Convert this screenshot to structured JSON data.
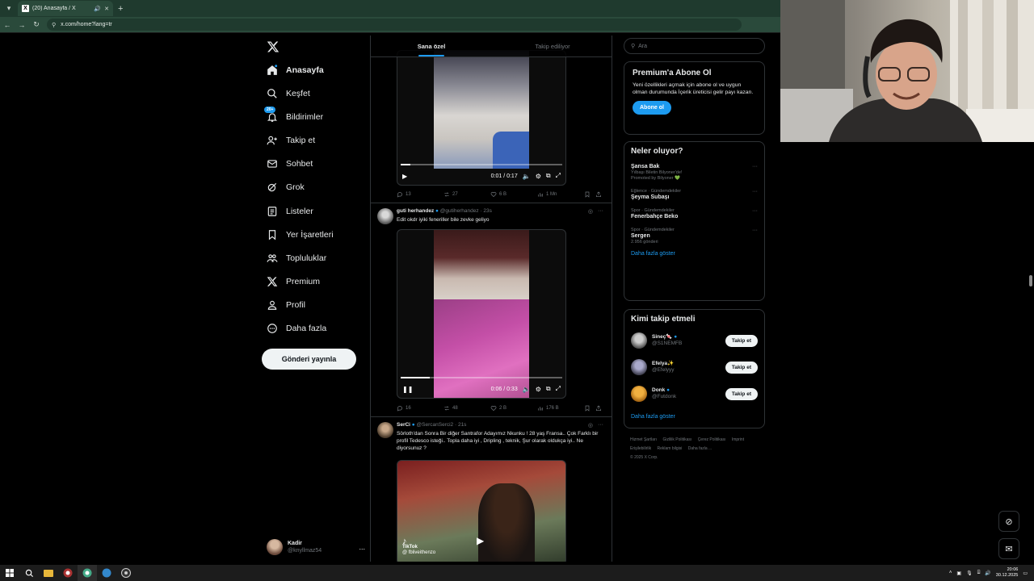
{
  "browser": {
    "tab_title": "(20) Anasayfa / X",
    "url": "x.com/home?lang=tr"
  },
  "nav": {
    "items": [
      {
        "label": "Anasayfa",
        "icon": "home-icon",
        "active": true
      },
      {
        "label": "Keşfet",
        "icon": "search-icon"
      },
      {
        "label": "Bildirimler",
        "icon": "bell-icon",
        "badge": "20+"
      },
      {
        "label": "Takip et",
        "icon": "add-person-icon"
      },
      {
        "label": "Sohbet",
        "icon": "mail-icon"
      },
      {
        "label": "Grok",
        "icon": "grok-icon"
      },
      {
        "label": "Listeler",
        "icon": "list-icon"
      },
      {
        "label": "Yer İşaretleri",
        "icon": "bookmark-icon"
      },
      {
        "label": "Topluluklar",
        "icon": "communities-icon"
      },
      {
        "label": "Premium",
        "icon": "x-logo-icon"
      },
      {
        "label": "Profil",
        "icon": "person-icon"
      },
      {
        "label": "Daha fazla",
        "icon": "more-circle-icon"
      }
    ],
    "post_button": "Gönderi yayınla",
    "account": {
      "name": "Kadir",
      "handle": "@knyllmaz54",
      "more": "..."
    }
  },
  "feed": {
    "tabs": [
      "Sana özel",
      "Takip ediliyor"
    ],
    "post1": {
      "time": "0:01 / 0:17",
      "progress": 0.06,
      "stats": {
        "replies": "13",
        "reposts": "27",
        "likes": "6 B",
        "views": "1 Mn"
      }
    },
    "post2": {
      "name": "guti herhandez",
      "handle": "@gutiherhandez",
      "time": "23s",
      "text": "Edit okdr iyiki feneriller bile zevke geliyo",
      "video_time": "0:06 / 0:33",
      "progress": 0.18,
      "stats": {
        "replies": "16",
        "reposts": "48",
        "likes": "2 B",
        "views": "176 B"
      }
    },
    "post3": {
      "name": "SerCi",
      "handle": "@SercanSerci2",
      "time": "21s",
      "text": "Sörloth'dan Sonra Bir diğer Santrafor Adayımız Nkunku ! 28 yaş Fransa.. Çok Farklı bir profil Tedesco isteği.. Topla daha iyi , Dripling , teknik, Şur olarak oldukça iyi.. Ne diyorsunuz ?",
      "overlay_brand": "TikTok",
      "overlay_handle": "@ fbliveithenzo"
    }
  },
  "right": {
    "search_placeholder": "Ara",
    "premium": {
      "title": "Premium'a Abone Ol",
      "text": "Yeni özellikleri açmak için abone ol ve uygun olman durumunda İçerik üreticisi gelir payı kazan.",
      "button": "Abone ol"
    },
    "trends": {
      "title": "Neler oluyor?",
      "items": [
        {
          "meta": "",
          "title": "Şansa Bak",
          "sub": "Yılbaşı Biletin Bilyoner'de!",
          "promo": "Promoted by Bilyoner 💚"
        },
        {
          "meta": "Eğlence · Gündemdekiler",
          "title": "Şeyma Subaşı",
          "sub": ""
        },
        {
          "meta": "Spor · Gündemdekiler",
          "title": "Fenerbahçe Beko",
          "sub": ""
        },
        {
          "meta": "Spor · Gündemdekiler",
          "title": "Sergen",
          "sub": "2.956 gönderi"
        }
      ],
      "show_more": "Daha fazla göster"
    },
    "who_to_follow": {
      "title": "Kimi takip etmeli",
      "users": [
        {
          "name": "Sineç🍬",
          "handle": "@S1NEMFB",
          "button": "Takip et"
        },
        {
          "name": "Efelya✨",
          "handle": "@Efelyyy",
          "button": "Takip et"
        },
        {
          "name": "Donk",
          "handle": "@Futdonk",
          "button": "Takip et"
        }
      ],
      "show_more": "Daha fazla göster"
    },
    "footer": [
      "Hizmet Şartları",
      "Gizlilik Politikası",
      "Çerez Politikası",
      "Imprint",
      "Erişilebilirlik",
      "Reklam bilgisi",
      "Daha fazla ...",
      "© 2025 X Corp."
    ]
  },
  "taskbar": {
    "time": "20:06",
    "date": "30.12.2025"
  },
  "colors": {
    "accent": "#1d9bf0",
    "background": "#000000",
    "border": "#2f3336",
    "chrome": "#2a4a3b"
  }
}
